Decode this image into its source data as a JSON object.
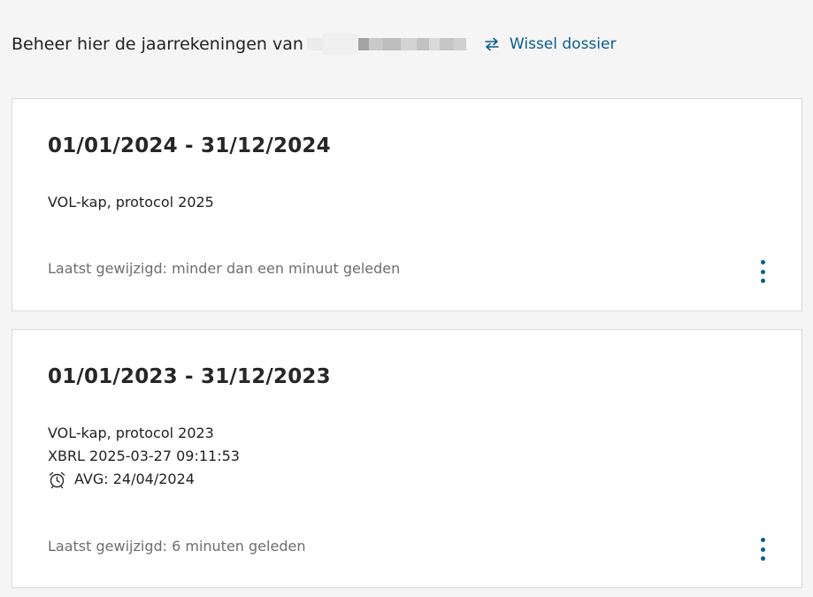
{
  "header": {
    "title": "Beheer hier de jaarrekeningen van",
    "switch_label": "Wissel dossier",
    "switch_icon": "swap-arrows-icon"
  },
  "cards": [
    {
      "period": "01/01/2024 - 31/12/2024",
      "lines": [
        "VOL-kap, protocol 2025"
      ],
      "modified": "Laatst gewijzigd: minder dan een minuut geleden"
    },
    {
      "period": "01/01/2023 - 31/12/2023",
      "lines": [
        "VOL-kap, protocol 2023",
        "XBRL 2025-03-27 09:11:53"
      ],
      "avg": "AVG: 24/04/2024",
      "avg_icon": "alarm-clock-icon",
      "modified": "Laatst gewijzigd: 6 minuten geleden"
    }
  ],
  "colors": {
    "accent": "#0b5d8f",
    "muted": "#6e6e6e",
    "background": "#f5f5f5"
  }
}
